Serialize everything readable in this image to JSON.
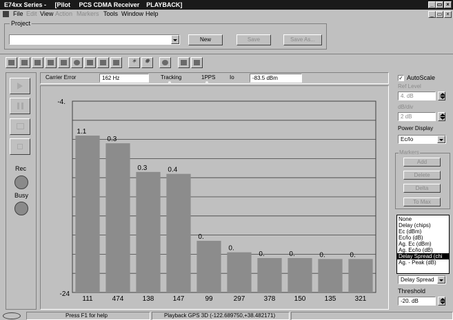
{
  "window": {
    "title": "E74xx Series -     [Pilot     PCS CDMA Receiver    PLAYBACK]"
  },
  "menu": {
    "items": [
      {
        "label": "File",
        "enabled": true
      },
      {
        "label": "Edit",
        "enabled": false
      },
      {
        "label": "View",
        "enabled": true
      },
      {
        "label": "Action",
        "enabled": false
      },
      {
        "label": "Markers",
        "enabled": false
      },
      {
        "label": "Tools",
        "enabled": true
      },
      {
        "label": "Window",
        "enabled": true
      },
      {
        "label": "Help",
        "enabled": true
      }
    ]
  },
  "project": {
    "group_label": "Project",
    "value": "",
    "new_label": "New",
    "save_label": "Save",
    "save_as_label": "Save As..."
  },
  "toolbar": {
    "icons": [
      "meter-icon",
      "table-icon",
      "bar-graph-icon",
      "spectrum-icon",
      "chart-icon",
      "globe-icon",
      "split-view-icon",
      "grid-icon",
      "scroll-icon",
      "star-icon",
      "star-outline-icon",
      "gear-icon",
      "document-icon",
      "documents-icon"
    ]
  },
  "measure": {
    "carrier_error_label": "Carrier Error",
    "carrier_error_value": "162 Hz",
    "tracking_label": "Tracking",
    "pps_label": "1PPS",
    "io_label": "Io",
    "io_value": "-83.5 dBm"
  },
  "transport": {
    "rec_label": "Rec",
    "busy_label": "Busy"
  },
  "right_panel": {
    "autoscale_label": "AutoScale",
    "autoscale_checked": true,
    "ref_level_label": "Ref Level",
    "ref_level_value": "4. dB",
    "db_div_label": "dB/div",
    "db_div_value": "2 dB",
    "power_display_label": "Power Display",
    "power_display_value": "Ec/Io",
    "markers_label": "Markers",
    "add_label": "Add",
    "delete_label": "Delete",
    "delta_label": "Delta",
    "to_max_label": "To Max",
    "bar_shade_options": [
      "None",
      "Delay (chips)",
      "Ec (dBm)",
      "Ec/Io (dB)",
      "Ag. Ec (dBm)",
      "Ag. Ec/Io (dB)",
      "Delay Spread (chi",
      "Ag. - Peak (dB)"
    ],
    "bar_shade_selected_index": 6,
    "bar_shade_value": "Delay Spread",
    "threshold_label": "Threshold",
    "threshold_value": "-20. dB"
  },
  "status": {
    "help_text": "Press F1 for help",
    "playback_text": "Playback GPS 3D (-122.689750,+38.482171)"
  },
  "chart_data": {
    "type": "bar",
    "categories": [
      "111",
      "474",
      "138",
      "147",
      "99",
      "297",
      "378",
      "150",
      "135",
      "321"
    ],
    "values": [
      -7.6,
      -8.4,
      -11.4,
      -11.6,
      -18.6,
      -19.8,
      -20.4,
      -20.4,
      -20.5,
      -20.5
    ],
    "bar_labels": [
      "1.1",
      "0.3",
      "0.3",
      "0.4",
      "0.",
      "0.",
      "0.",
      "0.",
      "0.",
      "0."
    ],
    "ylim": [
      -24,
      -4
    ],
    "y_ticks": [
      "-4.",
      "-24"
    ],
    "grid": true,
    "bar_color": "#8c8c8c"
  }
}
